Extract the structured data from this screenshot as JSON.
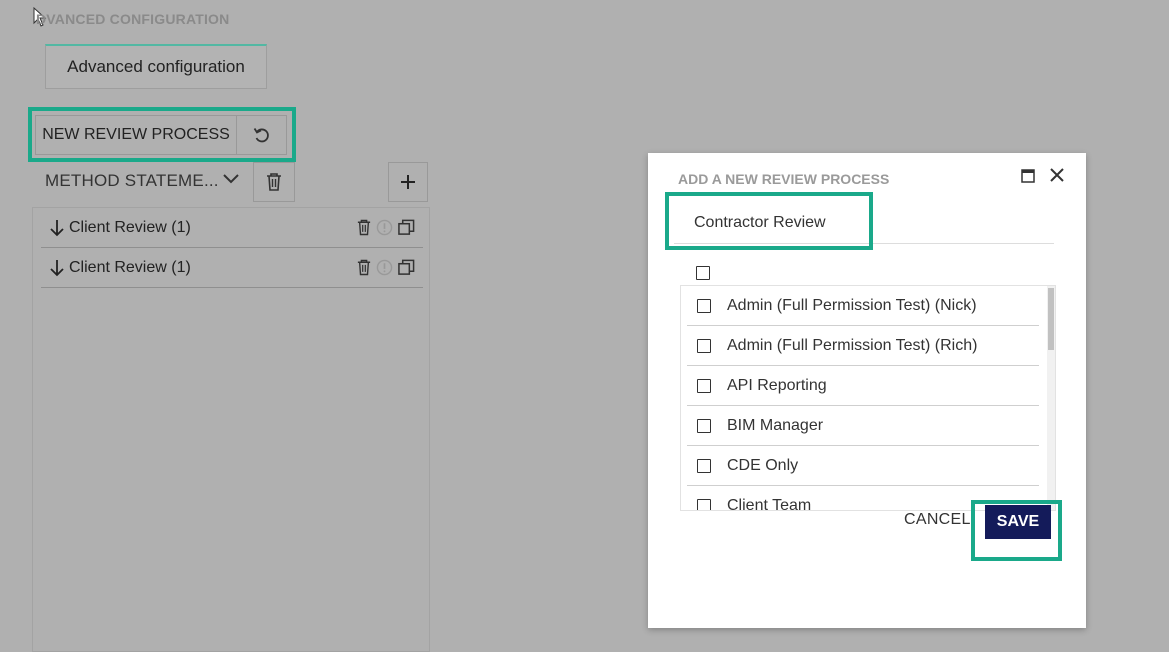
{
  "page": {
    "section_title": "DVANCED CONFIGURATION",
    "tab_label": "Advanced configuration",
    "new_review_label": "NEW REVIEW PROCESS",
    "method_label": "METHOD STATEME...",
    "review_rows": [
      {
        "label": "Client Review (1)"
      },
      {
        "label": "Client Review (1)"
      }
    ]
  },
  "modal": {
    "title": "ADD A NEW REVIEW PROCESS",
    "name_value": "Contractor Review",
    "items": [
      {
        "label": "Admin (Full Permission Test) (Nick)"
      },
      {
        "label": "Admin (Full Permission Test) (Rich)"
      },
      {
        "label": "API Reporting"
      },
      {
        "label": "BIM Manager"
      },
      {
        "label": "CDE Only"
      },
      {
        "label": "Client Team"
      }
    ],
    "cancel_label": "CANCEL",
    "save_label": "SAVE"
  },
  "colors": {
    "highlight": "#1aa98a",
    "save_bg": "#141b5a",
    "backdrop": "#b0b0b0"
  },
  "icons": {
    "undo": "undo-icon",
    "chevron": "chevron-down-icon",
    "trash": "trash-icon",
    "plus": "plus-icon",
    "arrow_down": "arrow-down-icon",
    "info": "info-icon",
    "copy": "copy-icon",
    "maximize": "maximize-icon",
    "close": "close-icon"
  }
}
